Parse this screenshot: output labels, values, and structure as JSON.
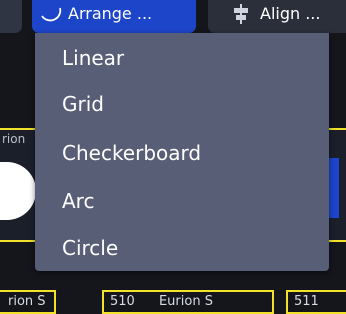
{
  "toolbar": {
    "arrange_label": "Arrange ...",
    "align_label": "Align ..."
  },
  "arrange_menu": {
    "items": [
      {
        "label": "Linear"
      },
      {
        "label": "Grid"
      },
      {
        "label": "Checkerboard"
      },
      {
        "label": "Arc"
      },
      {
        "label": "Circle"
      }
    ]
  },
  "background": {
    "left_node_fragment": "rion",
    "nodes": [
      {
        "id": "",
        "name": "rion S"
      },
      {
        "id": "510",
        "name": "Eurion S"
      },
      {
        "id": "511",
        "name": ""
      }
    ]
  },
  "colors": {
    "accent": "#1d45c9",
    "menu_bg": "#585e76",
    "node_outline": "#f2e22a",
    "canvas_bg": "#14161c"
  }
}
